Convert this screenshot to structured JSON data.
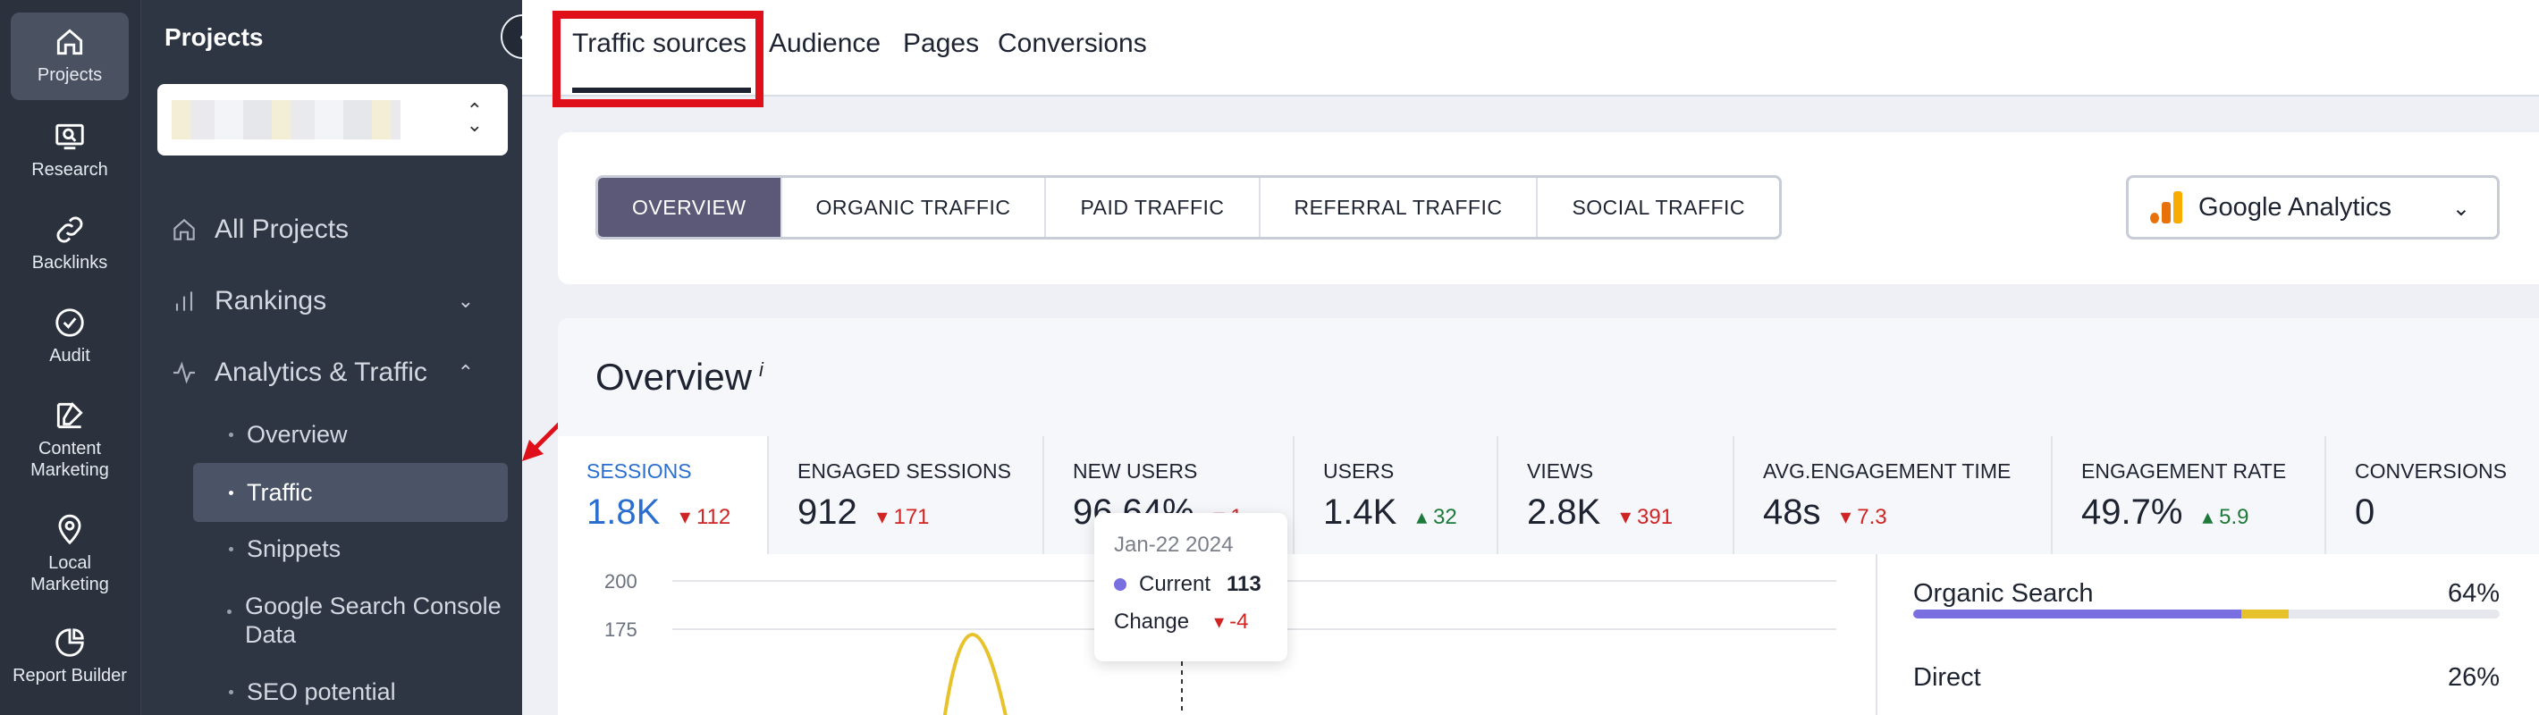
{
  "rail": {
    "items": [
      {
        "label": "Projects",
        "icon": "home-icon"
      },
      {
        "label": "Research",
        "icon": "research-icon"
      },
      {
        "label": "Backlinks",
        "icon": "link-icon"
      },
      {
        "label": "Audit",
        "icon": "check-circle-icon"
      },
      {
        "label": "Content Marketing",
        "icon": "edit-icon"
      },
      {
        "label": "Local Marketing",
        "icon": "location-pin-icon"
      },
      {
        "label": "Report Builder",
        "icon": "pie-chart-icon"
      }
    ]
  },
  "sidebar": {
    "title": "Projects",
    "nav": [
      {
        "label": "All Projects"
      },
      {
        "label": "Rankings"
      },
      {
        "label": "Analytics & Traffic"
      }
    ],
    "sub": [
      {
        "label": "Overview"
      },
      {
        "label": "Traffic"
      },
      {
        "label": "Snippets"
      },
      {
        "label": "Google Search Console Data"
      },
      {
        "label": "SEO potential"
      }
    ]
  },
  "tabs": [
    "Traffic sources",
    "Audience",
    "Pages",
    "Conversions"
  ],
  "filters": [
    "OVERVIEW",
    "ORGANIC TRAFFIC",
    "PAID TRAFFIC",
    "REFERRAL TRAFFIC",
    "SOCIAL TRAFFIC"
  ],
  "source_select": "Google Analytics",
  "overview": {
    "title": "Overview",
    "info_mark": "i",
    "metrics": [
      {
        "label": "SESSIONS",
        "value": "1.8K",
        "change": "112",
        "dir": "down"
      },
      {
        "label": "ENGAGED SESSIONS",
        "value": "912",
        "change": "171",
        "dir": "down"
      },
      {
        "label": "NEW USERS",
        "value": "96.64%",
        "change": "1",
        "dir": "down"
      },
      {
        "label": "USERS",
        "value": "1.4K",
        "change": "32",
        "dir": "up"
      },
      {
        "label": "VIEWS",
        "value": "2.8K",
        "change": "391",
        "dir": "down"
      },
      {
        "label": "AVG.ENGAGEMENT TIME",
        "value": "48s",
        "change": "7.3",
        "dir": "down"
      },
      {
        "label": "ENGAGEMENT RATE",
        "value": "49.7%",
        "change": "5.9",
        "dir": "up"
      },
      {
        "label": "CONVERSIONS",
        "value": "0",
        "change": "",
        "dir": ""
      }
    ],
    "y_ticks": [
      "200",
      "175"
    ],
    "tooltip": {
      "date": "Jan-22 2024",
      "current_label": "Current",
      "current_value": "113",
      "change_label": "Change",
      "change_value": "-4"
    },
    "sources": [
      {
        "label": "Organic Search",
        "pct": "64%",
        "value": 0.64
      },
      {
        "label": "Direct",
        "pct": "26%",
        "value": 0.26
      }
    ]
  },
  "colors": {
    "accent": "#2a6fd0",
    "highlight": "#e0101a",
    "filter_active": "#5c5878",
    "bar_purple": "#7a6fe0",
    "bar_yellow": "#e8c22a"
  }
}
